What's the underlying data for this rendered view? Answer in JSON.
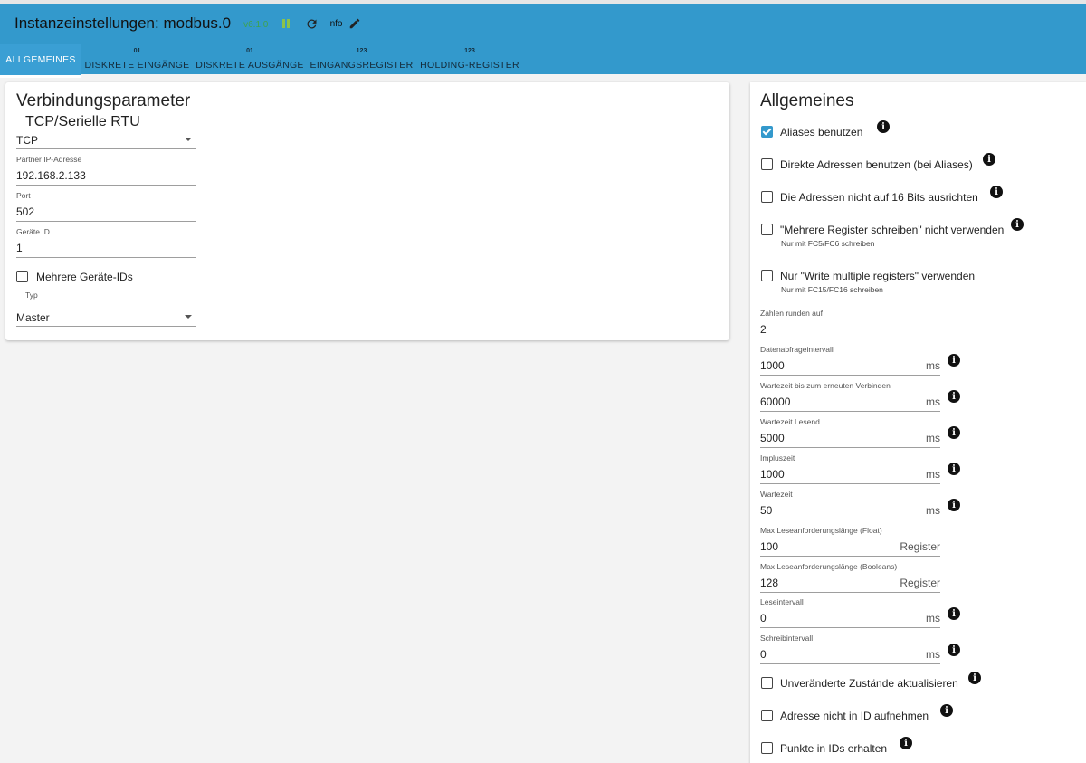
{
  "header": {
    "title": "Instanzeinstellungen: modbus.0",
    "version": "v6.1.0",
    "info_label": "info",
    "accent": "#3399cc"
  },
  "tabs": [
    {
      "label": "ALLGEMEINES",
      "icon": ""
    },
    {
      "label": "DISKRETE EINGÄNGE",
      "icon": "01"
    },
    {
      "label": "DISKRETE AUSGÄNGE",
      "icon": "01"
    },
    {
      "label": "EINGANGSREGISTER",
      "icon": "123"
    },
    {
      "label": "HOLDING-REGISTER",
      "icon": "123"
    }
  ],
  "connection": {
    "title": "Verbindungsparameter",
    "mode": {
      "label": "TCP/Serielle RTU",
      "value": "TCP"
    },
    "ip": {
      "label": "Partner IP-Adresse",
      "value": "192.168.2.133"
    },
    "port": {
      "label": "Port",
      "value": "502"
    },
    "device_id": {
      "label": "Geräte ID",
      "value": "1"
    },
    "multi_ids": {
      "label": "Mehrere Geräte-IDs",
      "checked": false
    },
    "type": {
      "label": "Typ",
      "value": "Master"
    }
  },
  "general": {
    "title": "Allgemeines",
    "checkboxes": [
      {
        "label": "Aliases benutzen",
        "checked": true,
        "sub": ""
      },
      {
        "label": "Direkte Adressen benutzen (bei Aliases)",
        "checked": false,
        "sub": ""
      },
      {
        "label": "Die Adressen nicht auf 16 Bits ausrichten",
        "checked": false,
        "sub": ""
      },
      {
        "label": "\"Mehrere Register schreiben\" nicht verwenden",
        "checked": false,
        "sub": "Nur mit FC5/FC6 schreiben"
      },
      {
        "label": "Nur \"Write multiple registers\" verwenden",
        "checked": false,
        "sub": "Nur mit FC15/FC16 schreiben"
      }
    ],
    "fields": [
      {
        "label": "Zahlen runden auf",
        "value": "2",
        "unit": ""
      },
      {
        "label": "Datenabfrageintervall",
        "value": "1000",
        "unit": "ms"
      },
      {
        "label": "Wartezeit bis zum erneuten Verbinden",
        "value": "60000",
        "unit": "ms"
      },
      {
        "label": "Wartezeit Lesend",
        "value": "5000",
        "unit": "ms"
      },
      {
        "label": "Impluszeit",
        "value": "1000",
        "unit": "ms"
      },
      {
        "label": "Wartezeit",
        "value": "50",
        "unit": "ms"
      },
      {
        "label": "Max Leseanforderungslänge (Float)",
        "value": "100",
        "unit": "Register"
      },
      {
        "label": "Max Leseanforderungslänge (Booleans)",
        "value": "128",
        "unit": "Register"
      },
      {
        "label": "Leseintervall",
        "value": "0",
        "unit": "ms"
      },
      {
        "label": "Schreibintervall",
        "value": "0",
        "unit": "ms"
      }
    ],
    "bottom_checkboxes": [
      {
        "label": "Unveränderte Zustände aktualisieren",
        "checked": false
      },
      {
        "label": "Adresse nicht in ID aufnehmen",
        "checked": false
      },
      {
        "label": "Punkte in IDs erhalten",
        "checked": false
      }
    ]
  }
}
